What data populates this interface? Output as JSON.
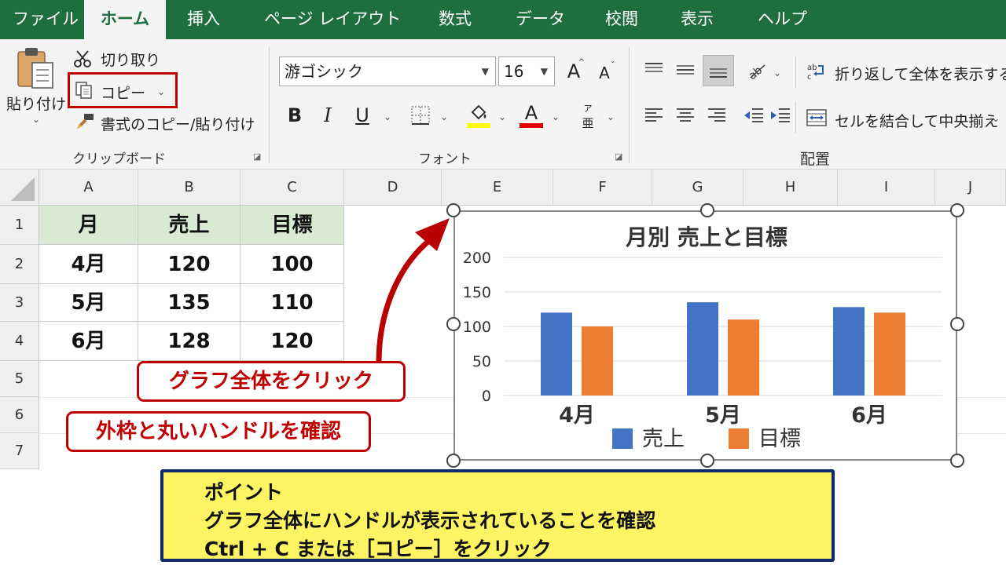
{
  "menu": {
    "tabs": [
      "ファイル",
      "ホーム",
      "挿入",
      "ページ レイアウト",
      "数式",
      "データ",
      "校閲",
      "表示",
      "ヘルプ"
    ],
    "active": "ホーム"
  },
  "ribbon": {
    "clipboard": {
      "paste_label": "貼り付け",
      "cut_label": "切り取り",
      "copy_label": "コピー",
      "format_painter_label": "書式のコピー/貼り付け",
      "group_label": "クリップボード"
    },
    "font": {
      "font_name": "游ゴシック",
      "font_size": "16",
      "bold": "B",
      "italic": "I",
      "underline": "U",
      "font_color_glyph": "A",
      "grow_glyph": "A",
      "shrink_glyph": "A",
      "furigana_glyph": "亜",
      "group_label": "フォント",
      "fill_color": "#ffff00",
      "font_color": "#e00000"
    },
    "alignment": {
      "wrap_label": "折り返して全体を表示する",
      "merge_label": "セルを結合して中央揃え",
      "group_label": "配置"
    }
  },
  "sheet": {
    "columns": [
      "A",
      "B",
      "C",
      "D",
      "E",
      "F",
      "G",
      "H",
      "I",
      "J"
    ],
    "rows": [
      "1",
      "2",
      "3",
      "4",
      "5",
      "6",
      "7"
    ],
    "table": {
      "headers": [
        "月",
        "売上",
        "目標"
      ],
      "rows": [
        [
          "4月",
          "120",
          "100"
        ],
        [
          "5月",
          "135",
          "110"
        ],
        [
          "6月",
          "128",
          "120"
        ]
      ]
    }
  },
  "chart_data": {
    "type": "bar",
    "title": "月別 売上と目標",
    "categories": [
      "4月",
      "5月",
      "6月"
    ],
    "series": [
      {
        "name": "売上",
        "values": [
          120,
          135,
          128
        ],
        "color": "#4472c4"
      },
      {
        "name": "目標",
        "values": [
          100,
          110,
          120
        ],
        "color": "#ed7d31"
      }
    ],
    "ylim": [
      0,
      200
    ],
    "yticks": [
      "0",
      "50",
      "100",
      "150",
      "200"
    ],
    "grid": true,
    "legend": "bottom"
  },
  "callouts": {
    "click_chart": "グラフ全体をクリック",
    "check_handles": "外枠と丸いハンドルを確認"
  },
  "point": {
    "title": "ポイント",
    "line1": "グラフ全体にハンドルが表示されていることを確認",
    "line2": "Ctrl + C または［コピー］をクリック"
  },
  "colors": {
    "menu_green": "#1e6e3e",
    "callout_red": "#c00000",
    "header_green": "#d9ead3",
    "point_yellow": "#fdf463",
    "point_border": "#102a6b"
  }
}
